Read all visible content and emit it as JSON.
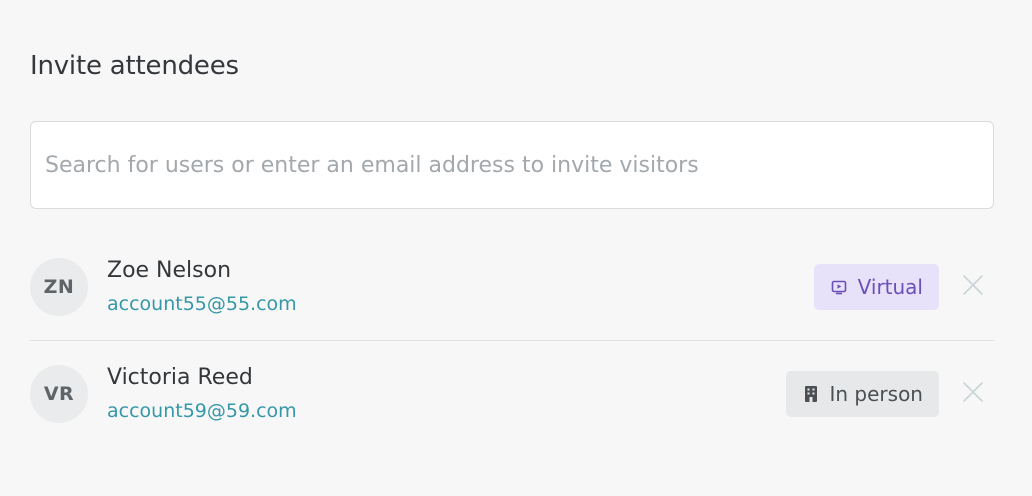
{
  "header": {
    "title": "Invite attendees"
  },
  "search": {
    "placeholder": "Search for users or enter an email address to invite visitors",
    "value": ""
  },
  "attendees": [
    {
      "initials": "ZN",
      "name": "Zoe Nelson",
      "email": "account55@55.com",
      "mode_label": "Virtual",
      "mode_icon": "screen-play-icon"
    },
    {
      "initials": "VR",
      "name": "Victoria Reed",
      "email": "account59@59.com",
      "mode_label": "In person",
      "mode_icon": "building-icon"
    }
  ],
  "colors": {
    "background": "#f7f7f7",
    "link": "#3598a8",
    "virtual_badge_bg": "#e7e2f9",
    "virtual_badge_text": "#6b50b8",
    "inperson_badge_bg": "#e7e8e9",
    "avatar_bg": "#e9ebec"
  }
}
